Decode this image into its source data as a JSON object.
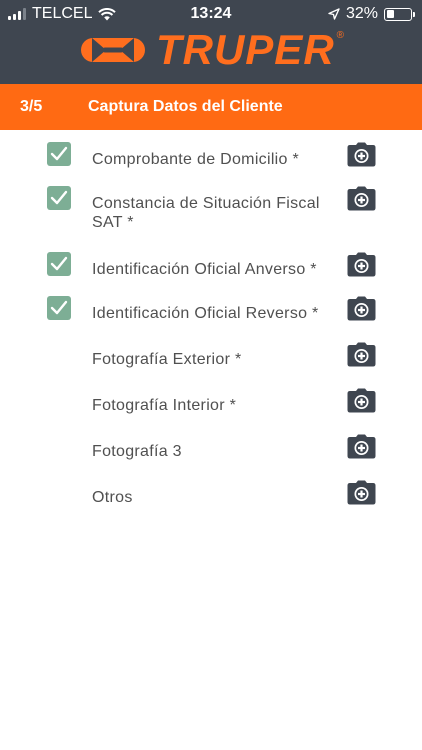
{
  "status_bar": {
    "carrier": "TELCEL",
    "time": "13:24",
    "battery": "32%",
    "battery_level": 0.32
  },
  "brand": {
    "name": "TRUPER",
    "registered": "®",
    "color": "#ff6e1e"
  },
  "step_bar": {
    "step": "3/5",
    "title": "Captura Datos del Cliente",
    "color": "#ff6a13"
  },
  "documents": [
    {
      "label": "Comprobante de Domicilio *",
      "checked": true
    },
    {
      "label": "Constancia de Situación Fiscal SAT *",
      "checked": true
    },
    {
      "label": "Identificación Oficial Anverso *",
      "checked": true
    },
    {
      "label": "Identificación Oficial Reverso *",
      "checked": true
    },
    {
      "label": "Fotografía Exterior *",
      "checked": false
    },
    {
      "label": "Fotografía Interior *",
      "checked": false
    },
    {
      "label": "Fotografía 3",
      "checked": false
    },
    {
      "label": "Otros",
      "checked": false
    }
  ],
  "icons": {
    "checkbox": "check-icon",
    "camera": "camera-add-icon"
  },
  "colors": {
    "header": "#3f4650",
    "check": "#7dae95",
    "camera": "#3f4650",
    "text": "#505050"
  }
}
